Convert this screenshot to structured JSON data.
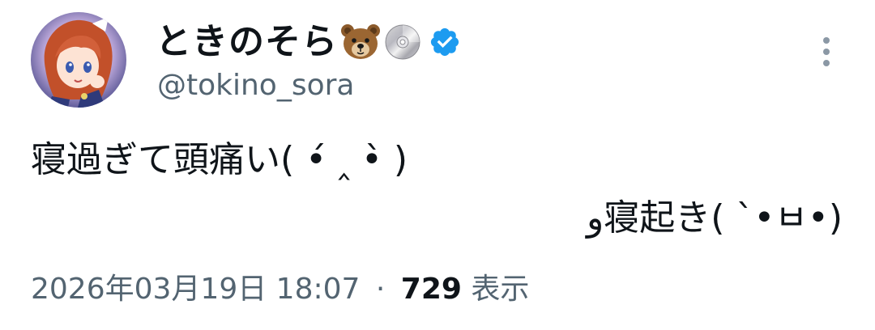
{
  "user": {
    "display_name": "ときのそら",
    "handle": "@tokino_sora",
    "name_emojis": [
      "bear-face",
      "optical-disc"
    ],
    "verified": true
  },
  "tweet": {
    "text_line1": "寝過ぎて頭痛い( •́ ‸ •̀ )",
    "text_line2": "و寝起き( ˋ•ㅂ•)"
  },
  "meta": {
    "datetime": "2026年03月19日 18:07",
    "separator": "·",
    "views_count": "729",
    "views_label": "表示"
  },
  "colors": {
    "text_primary": "#0f1419",
    "text_secondary": "#536471",
    "verified_blue": "#1d9bf0"
  }
}
